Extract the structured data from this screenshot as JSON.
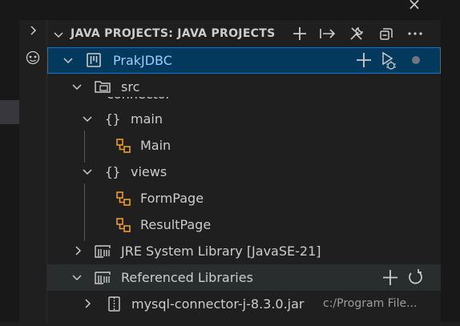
{
  "window": {
    "close_glyph": "×"
  },
  "panel": {
    "title": "JAVA PROJECTS: JAVA PROJECTS",
    "header_actions": [
      "plus-icon",
      "link-arrow-icon",
      "tools-icon",
      "collapse-all-icon",
      "more-icon"
    ]
  },
  "tree": {
    "project": {
      "label": "PrakJDBC",
      "actions": [
        "plus-icon",
        "run-debug-icon"
      ]
    },
    "src": {
      "label": "src"
    },
    "partial_label": "connector",
    "main": {
      "label": "main"
    },
    "main_class": {
      "label": "Main"
    },
    "views": {
      "label": "views"
    },
    "form_page": {
      "label": "FormPage"
    },
    "result_page": {
      "label": "ResultPage"
    },
    "jre": {
      "label": "JRE System Library [JavaSE-21]"
    },
    "ref_libs": {
      "label": "Referenced Libraries",
      "actions": [
        "plus-icon",
        "refresh-icon"
      ]
    },
    "jar": {
      "label": "mysql-connector-j-8.3.0.jar",
      "description": "c:/Program File..."
    }
  },
  "colors": {
    "selection_bg": "#04395e",
    "selection_border": "#0078d4",
    "class_icon": "#ee9d28",
    "panel_bg": "#1f1f1f"
  }
}
